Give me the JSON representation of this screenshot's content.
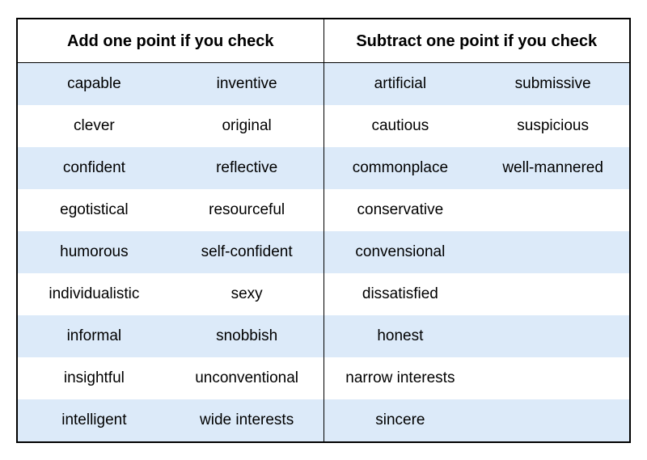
{
  "headers": {
    "add": "Add one point if you check",
    "subtract": "Subtract one point if you check"
  },
  "add": {
    "col1": [
      "capable",
      "clever",
      "confident",
      "egotistical",
      "humorous",
      "individualistic",
      "informal",
      "insightful",
      "intelligent"
    ],
    "col2": [
      "inventive",
      "original",
      "reflective",
      "resourceful",
      "self-confident",
      "sexy",
      "snobbish",
      "unconventional",
      "wide interests"
    ]
  },
  "subtract": {
    "col1": [
      "artificial",
      "cautious",
      "commonplace",
      "conservative",
      "convensional",
      "dissatisfied",
      "honest",
      "narrow interests",
      "sincere"
    ],
    "col2": [
      "submissive",
      "suspicious",
      "well-mannered",
      "",
      "",
      "",
      "",
      "",
      ""
    ]
  }
}
